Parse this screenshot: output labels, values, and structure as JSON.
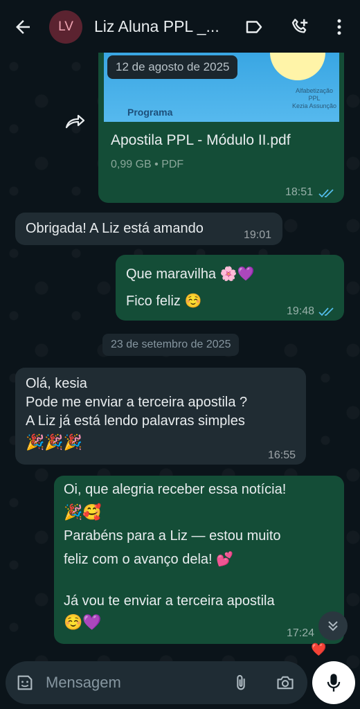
{
  "header": {
    "avatar_initials": "LV",
    "title": "Liz Aluna PPL _..."
  },
  "messages": {
    "doc": {
      "date_overlay": "12 de agosto de 2025",
      "preview_small_text_1": "Alfabetização PPL",
      "preview_small_text_2": "Kezia Assunção",
      "preview_title": "Programa",
      "filename": "Apostila PPL - Módulo II.pdf",
      "meta": "0,99 GB • PDF",
      "time": "18:51"
    },
    "m1": {
      "text": "Obrigada! A Liz está amando",
      "time": "19:01"
    },
    "m2": {
      "line1": "Que maravilha",
      "emoji1": "🌸💜",
      "line2": "Fico feliz",
      "emoji2": "☺️",
      "time": "19:48"
    },
    "date_chip": "23 de setembro de 2025",
    "m3": {
      "line1": "Olá, kesia",
      "line2": "Pode me enviar a terceira apostila ?",
      "line3": "A Liz já está lendo palavras simples",
      "emojis": "🎉🎉🎉",
      "time": "16:55"
    },
    "m4": {
      "line1": "Oi, que alegria receber essa notícia!",
      "emoji1": "🎉🥰",
      "line2": "Parabéns para a Liz — estou muito",
      "line3": "feliz com o avanço dela!",
      "emoji3": "💕",
      "line4": "Já vou te enviar a terceira apostila",
      "emoji4": "☺️💜",
      "time": "17:24",
      "reaction": "❤️"
    }
  },
  "input": {
    "placeholder": "Mensagem"
  },
  "icons": {
    "back": "arrow-left-icon",
    "label": "label-icon",
    "call": "add-call-icon",
    "menu": "more-vert-icon",
    "forward": "forward-icon",
    "sticker": "sticker-icon",
    "attach": "paperclip-icon",
    "camera": "camera-icon",
    "mic": "mic-icon",
    "scroll": "chevrons-down-icon"
  },
  "colors": {
    "outgoing": "#144d37",
    "incoming": "#202c33",
    "background": "#0b141a",
    "read_ticks": "#53bdeb"
  }
}
